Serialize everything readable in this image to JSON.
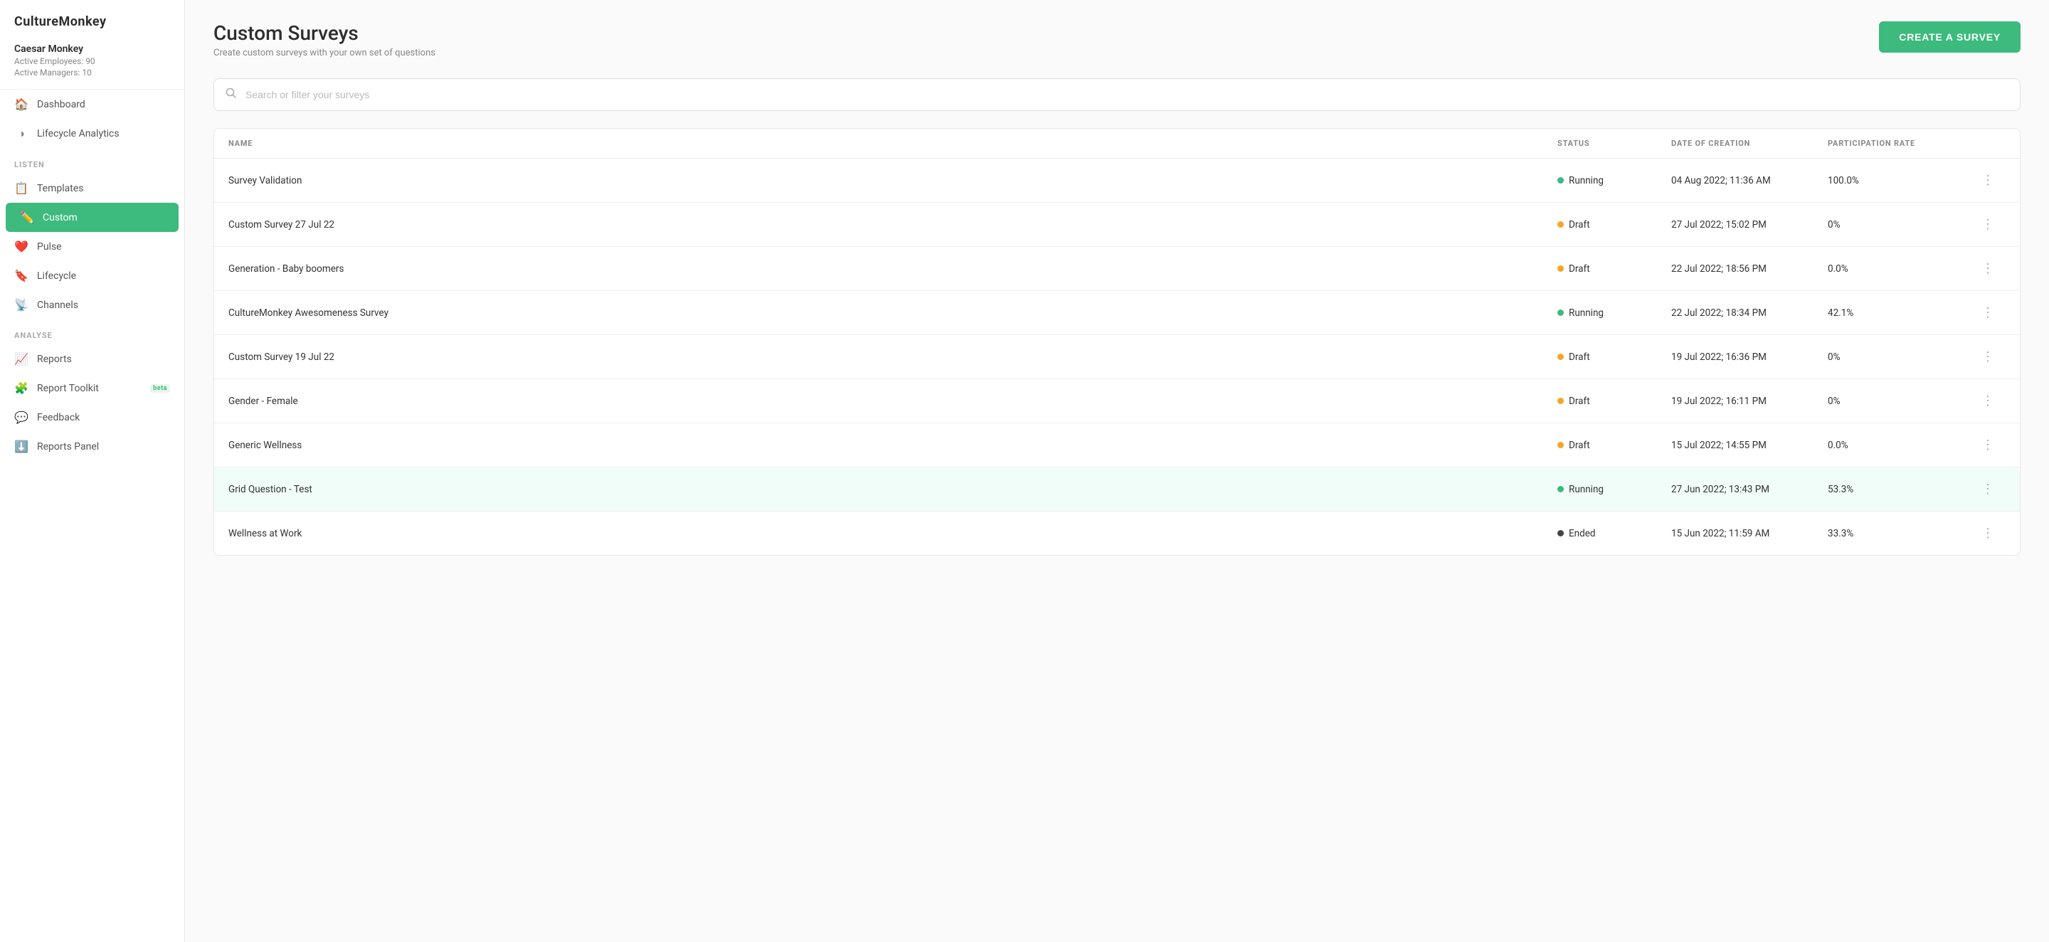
{
  "app": {
    "name": "CultureMonkey"
  },
  "user": {
    "name": "Caesar Monkey",
    "active_employees_label": "Active Employees: 90",
    "active_managers_label": "Active Managers: 10"
  },
  "sidebar": {
    "main_nav": [
      {
        "id": "dashboard",
        "label": "Dashboard",
        "icon": "🏠",
        "active": false
      },
      {
        "id": "lifecycle-analytics",
        "label": "Lifecycle Analytics",
        "icon": "◑",
        "active": false
      }
    ],
    "listen_section_label": "LISTEN",
    "listen_nav": [
      {
        "id": "templates",
        "label": "Templates",
        "icon": "📋",
        "active": false
      },
      {
        "id": "custom",
        "label": "Custom",
        "icon": "✏️",
        "active": true
      },
      {
        "id": "pulse",
        "label": "Pulse",
        "icon": "❤️",
        "active": false
      },
      {
        "id": "lifecycle",
        "label": "Lifecycle",
        "icon": "🔖",
        "active": false
      },
      {
        "id": "channels",
        "label": "Channels",
        "icon": "📡",
        "active": false
      }
    ],
    "analyse_section_label": "ANALYSE",
    "analyse_nav": [
      {
        "id": "reports",
        "label": "Reports",
        "icon": "📈",
        "active": false
      },
      {
        "id": "report-toolkit",
        "label": "Report Toolkit",
        "icon": "🧩",
        "active": false,
        "beta": true
      },
      {
        "id": "feedback",
        "label": "Feedback",
        "icon": "💬",
        "active": false
      },
      {
        "id": "reports-panel",
        "label": "Reports Panel",
        "icon": "⬇️",
        "active": false
      }
    ]
  },
  "page": {
    "title": "Custom Surveys",
    "subtitle": "Create custom surveys with your own set of questions",
    "create_button_label": "CREATE A SURVEY"
  },
  "search": {
    "placeholder": "Search or filter your surveys"
  },
  "table": {
    "columns": [
      "NAME",
      "STATUS",
      "DATE OF CREATION",
      "PARTICIPATION RATE",
      ""
    ],
    "rows": [
      {
        "name": "Survey Validation",
        "status": "Running",
        "status_type": "running",
        "date": "04 Aug 2022; 11:36 AM",
        "rate": "100.0%",
        "highlighted": false
      },
      {
        "name": "Custom Survey 27 Jul 22",
        "status": "Draft",
        "status_type": "draft",
        "date": "27 Jul 2022; 15:02 PM",
        "rate": "0%",
        "highlighted": false
      },
      {
        "name": "Generation - Baby boomers",
        "status": "Draft",
        "status_type": "draft",
        "date": "22 Jul 2022; 18:56 PM",
        "rate": "0.0%",
        "highlighted": false
      },
      {
        "name": "CultureMonkey Awesomeness Survey",
        "status": "Running",
        "status_type": "running",
        "date": "22 Jul 2022; 18:34 PM",
        "rate": "42.1%",
        "highlighted": false
      },
      {
        "name": "Custom Survey 19 Jul 22",
        "status": "Draft",
        "status_type": "draft",
        "date": "19 Jul 2022; 16:36 PM",
        "rate": "0%",
        "highlighted": false
      },
      {
        "name": "Gender - Female",
        "status": "Draft",
        "status_type": "draft",
        "date": "19 Jul 2022; 16:11 PM",
        "rate": "0%",
        "highlighted": false
      },
      {
        "name": "Generic Wellness",
        "status": "Draft",
        "status_type": "draft",
        "date": "15 Jul 2022; 14:55 PM",
        "rate": "0.0%",
        "highlighted": false
      },
      {
        "name": "Grid Question - Test",
        "status": "Running",
        "status_type": "running",
        "date": "27 Jun 2022; 13:43 PM",
        "rate": "53.3%",
        "highlighted": true
      },
      {
        "name": "Wellness at Work",
        "status": "Ended",
        "status_type": "ended",
        "date": "15 Jun 2022; 11:59 AM",
        "rate": "33.3%",
        "highlighted": false
      }
    ]
  }
}
